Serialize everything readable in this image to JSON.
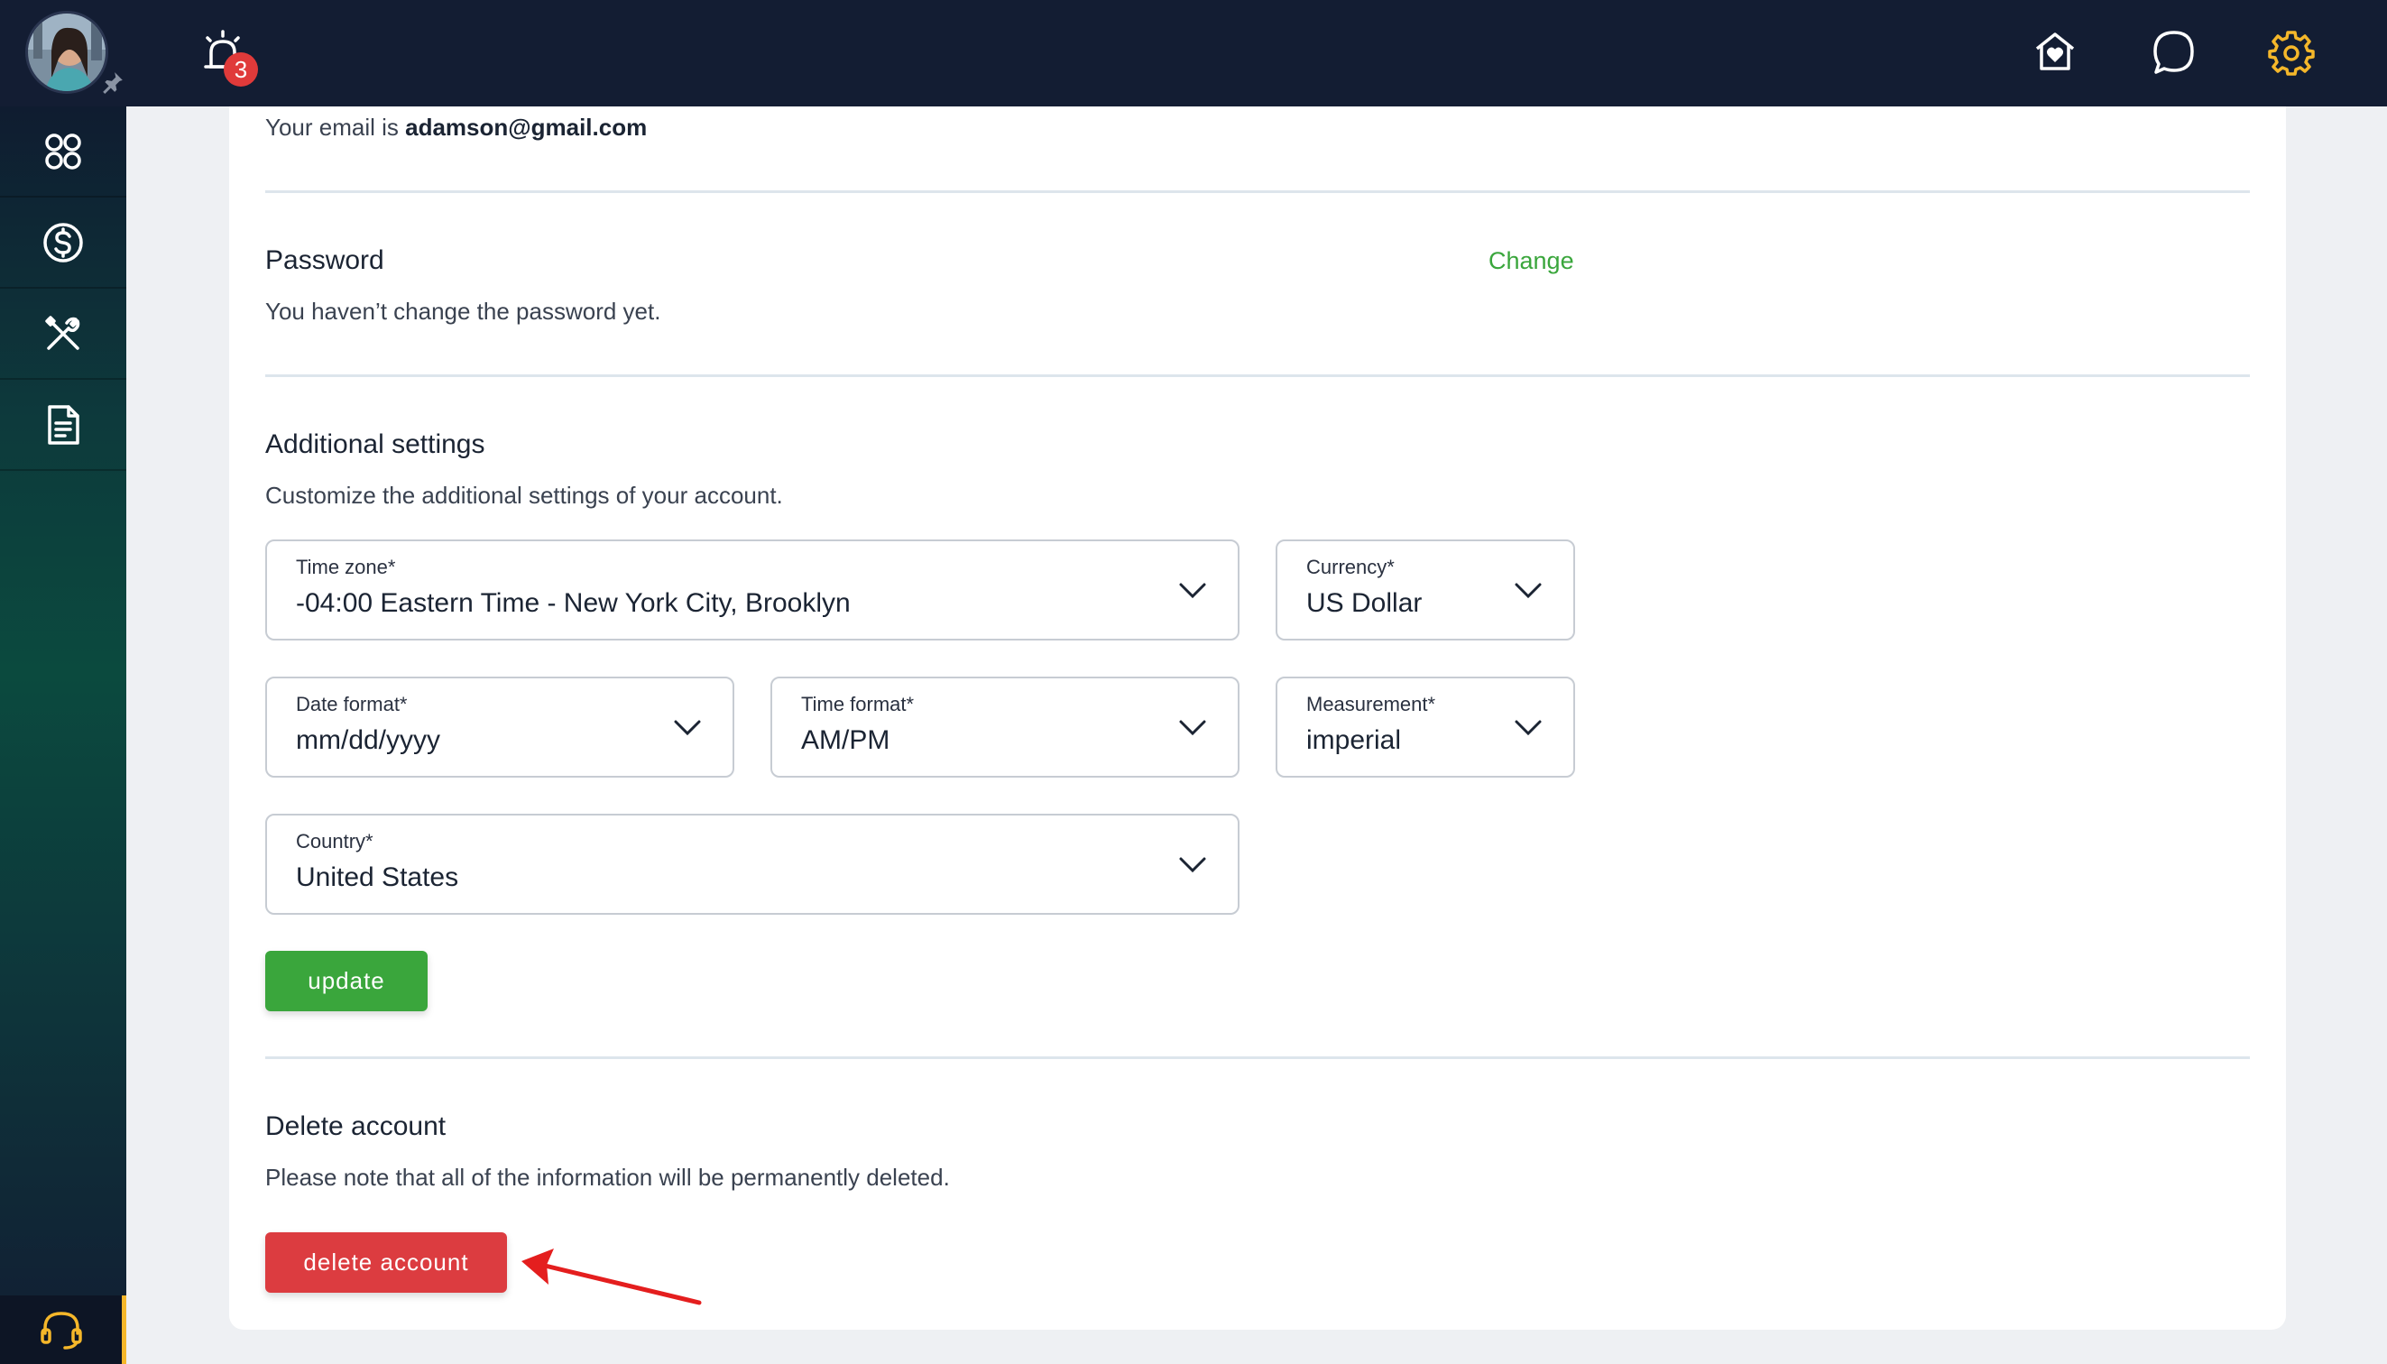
{
  "header": {
    "notification_count": "3",
    "accent_color": "#f5b72a",
    "icons": [
      "alarm-icon",
      "home-heart-icon",
      "chat-icon",
      "gear-icon"
    ]
  },
  "sidebar": {
    "items": [
      "apps-icon",
      "dollar-icon",
      "tools-icon",
      "document-icon"
    ],
    "support_icon": "headset-icon"
  },
  "email": {
    "prefix": "Your email is ",
    "address": "adamson@gmail.com"
  },
  "password": {
    "title": "Password",
    "change_label": "Change",
    "description": "You haven’t change the password yet."
  },
  "additional_settings": {
    "title": "Additional settings",
    "description": "Customize the additional settings of your account.",
    "timezone": {
      "label": "Time zone*",
      "value": "-04:00 Eastern Time - New York City, Brooklyn"
    },
    "currency": {
      "label": "Currency*",
      "value": "US Dollar"
    },
    "date_format": {
      "label": "Date format*",
      "value": "mm/dd/yyyy"
    },
    "time_format": {
      "label": "Time format*",
      "value": "AM/PM"
    },
    "measurement": {
      "label": "Measurement*",
      "value": "imperial"
    },
    "country": {
      "label": "Country*",
      "value": "United States"
    },
    "update_label": "update"
  },
  "delete_account": {
    "title": "Delete account",
    "description": "Please note that all of the information will be permanently deleted.",
    "button_label": "delete account"
  }
}
